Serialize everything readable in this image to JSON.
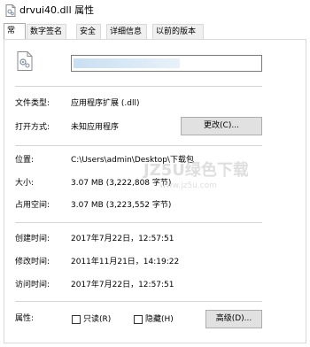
{
  "window": {
    "title": "drvui40.dll 属性"
  },
  "tabs": [
    {
      "label": "常规",
      "active": true
    },
    {
      "label": "数字签名",
      "active": false
    },
    {
      "label": "安全",
      "active": false
    },
    {
      "label": "详细信息",
      "active": false
    },
    {
      "label": "以前的版本",
      "active": false
    }
  ],
  "general": {
    "file_name": "",
    "file_type_label": "文件类型:",
    "file_type_value": "应用程序扩展 (.dll)",
    "open_with_label": "打开方式:",
    "open_with_value": "未知应用程序",
    "change_button": "更改(C)...",
    "location_label": "位置:",
    "location_value": "C:\\Users\\admin\\Desktop\\下载包",
    "size_label": "大小:",
    "size_value": "3.07 MB (3,222,808 字节)",
    "size_on_disk_label": "占用空间:",
    "size_on_disk_value": "3.07 MB (3,223,552 字节)",
    "created_label": "创建时间:",
    "created_value": "2017年7月22日，12:57:51",
    "modified_label": "修改时间:",
    "modified_value": "2011年11月21日，14:19:22",
    "accessed_label": "访问时间:",
    "accessed_value": "2017年7月22日，12:57:51",
    "attributes_label": "属性:",
    "readonly_label": "只读(R)",
    "readonly_checked": false,
    "hidden_label": "隐藏(H)",
    "hidden_checked": false,
    "advanced_button": "高级(D)..."
  },
  "watermark": {
    "text": "JZ5U绿色下载",
    "url": "www.jz5u.com"
  },
  "colors": {
    "button_bg": "#e1e1e1",
    "border": "#adadad",
    "separator": "#d5d5d5"
  }
}
